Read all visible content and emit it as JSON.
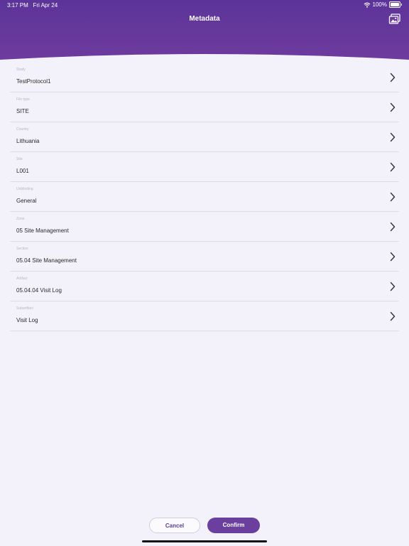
{
  "status_bar": {
    "time": "3:17 PM",
    "date": "Fri Apr 24",
    "battery": "100%"
  },
  "header": {
    "title": "Metadata",
    "background_color": "#6a3a9c",
    "action_icon": "photo-gallery-icon"
  },
  "fields": [
    {
      "label": "Study",
      "value": "TestProtocol1"
    },
    {
      "label": "File type",
      "value": "SITE"
    },
    {
      "label": "Country",
      "value": "Lithuania"
    },
    {
      "label": "Site",
      "value": "L001"
    },
    {
      "label": "Unblinding",
      "value": "General"
    },
    {
      "label": "Zone",
      "value": "05 Site Management"
    },
    {
      "label": "Section",
      "value": "05.04 Site Management"
    },
    {
      "label": "Artifact",
      "value": "05.04.04 Visit Log"
    },
    {
      "label": "Subartifact",
      "value": "Visit Log"
    }
  ],
  "footer": {
    "cancel_label": "Cancel",
    "confirm_label": "Confirm",
    "accent_color": "#6b3f9d"
  }
}
